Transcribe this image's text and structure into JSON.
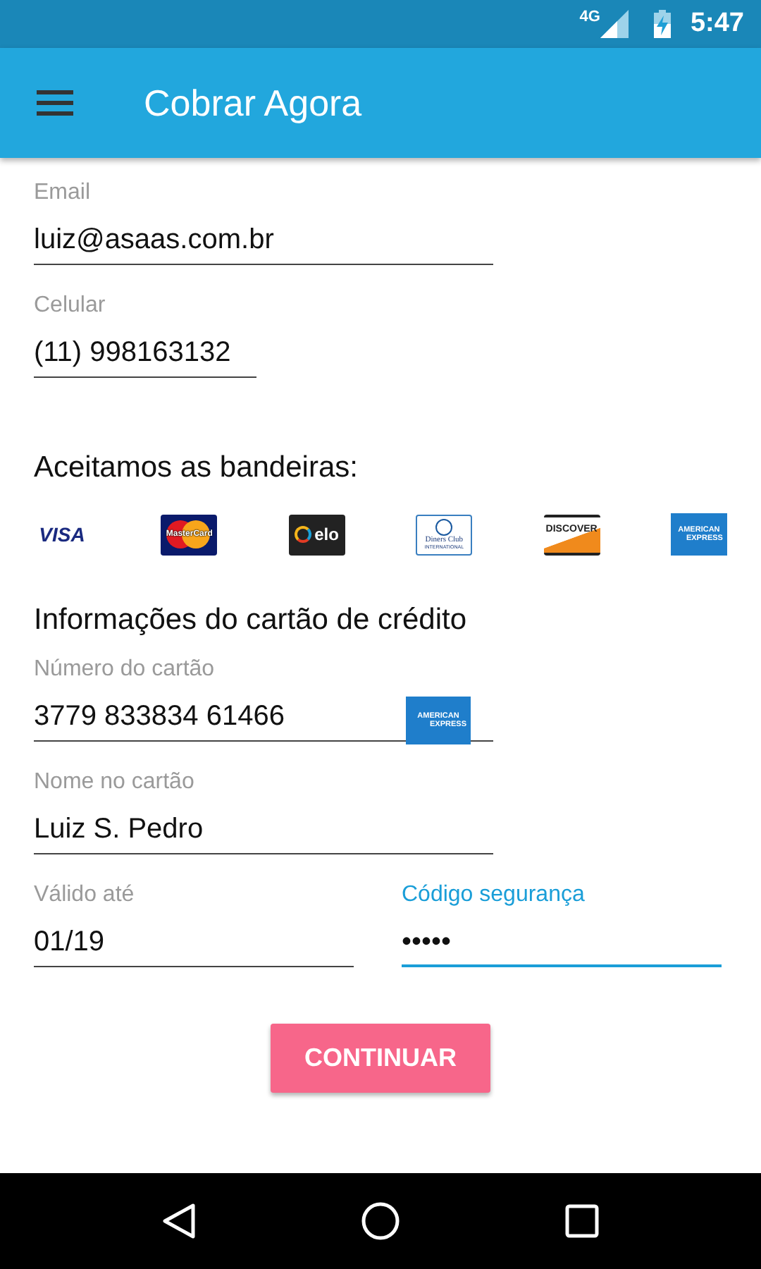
{
  "status_bar": {
    "network": "4G",
    "time": "5:47"
  },
  "app_bar": {
    "title": "Cobrar Agora"
  },
  "contact_fields": [
    {
      "label": "Email",
      "value": "luiz@asaas.com.br",
      "focused": false,
      "kind": "wide"
    },
    {
      "label": "Celular",
      "value": "(11) 998163132",
      "focused": false,
      "kind": "short"
    }
  ],
  "brands_title": "Aceitamos as bandeiras:",
  "brands": [
    {
      "kind": "visa",
      "text": "VISA"
    },
    {
      "kind": "mastercard",
      "text": "MasterCard"
    },
    {
      "kind": "elo",
      "text": "elo"
    },
    {
      "kind": "diners",
      "text": "Diners Club",
      "subtext": "INTERNATIONAL"
    },
    {
      "kind": "discover",
      "text": "DISCOVER"
    },
    {
      "kind": "amex",
      "text": "AMERICAN",
      "subtext": "EXPRESS"
    }
  ],
  "card_title": "Informações do cartão de crédito",
  "card_number": {
    "label": "Número do cartão",
    "value": "3779 833834 61466",
    "focused": false,
    "kind": "wide",
    "brand_logo": {
      "text": "AMERICAN",
      "subtext": "EXPRESS"
    }
  },
  "card_name": {
    "label": "Nome no cartão",
    "value": "Luiz S. Pedro",
    "focused": false,
    "kind": "wide"
  },
  "expiry": {
    "label": "Válido até",
    "value": "01/19",
    "focused": false,
    "kind": "half"
  },
  "security_code": {
    "label": "Código segurança",
    "value": "•••••",
    "focused": true,
    "kind": "half"
  },
  "continue_button": "CONTINUAR"
}
